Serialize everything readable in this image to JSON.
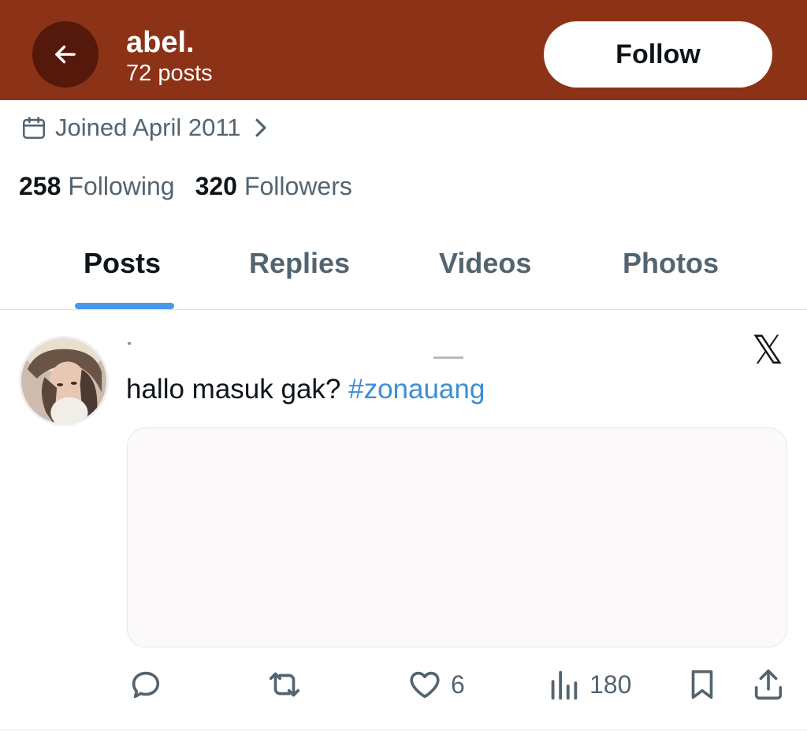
{
  "header": {
    "name": "abel.",
    "posts_count": "72 posts",
    "follow_label": "Follow",
    "background_color": "#8c3216",
    "back_icon": "arrow-left-icon"
  },
  "profile": {
    "joined": "Joined April 2011",
    "following_count": "258",
    "following_label": "Following",
    "followers_count": "320",
    "followers_label": "Followers"
  },
  "tabs": [
    {
      "label": "Posts",
      "active": true
    },
    {
      "label": "Replies",
      "active": false
    },
    {
      "label": "Videos",
      "active": false
    },
    {
      "label": "Photos",
      "active": false
    }
  ],
  "post": {
    "text": "hallo masuk gak? ",
    "hashtag": "#zonauang",
    "x_logo": "𝕏",
    "likes": "6",
    "views": "180",
    "accent_color": "#3d8ed6"
  }
}
